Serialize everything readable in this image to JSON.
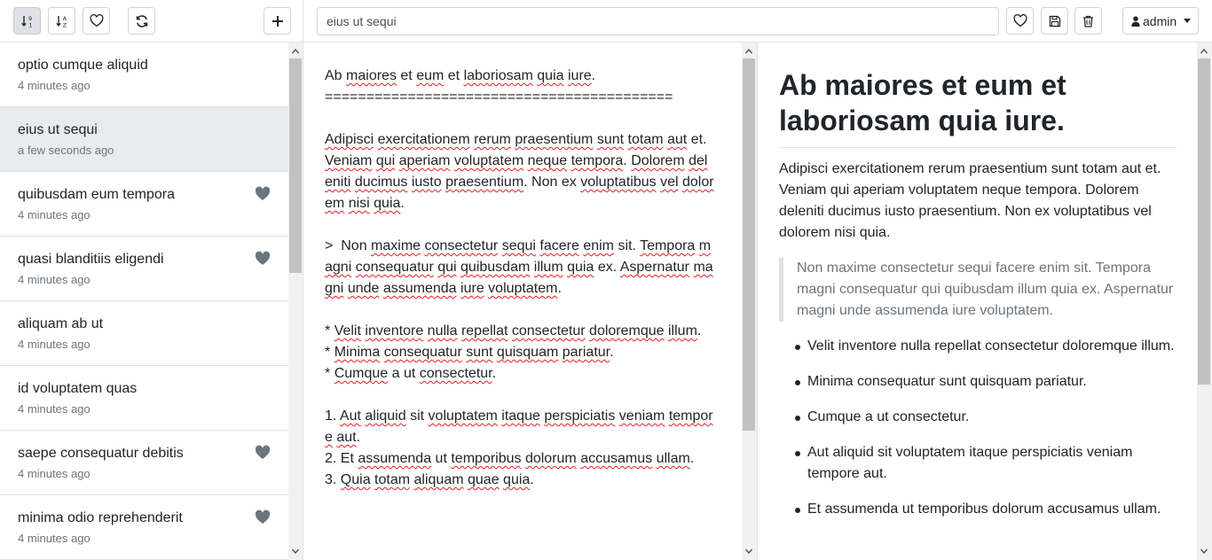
{
  "toolbar": {
    "sort_numeric_icon": "sort-numeric-down-icon",
    "sort_alpha_icon": "sort-alpha-down-icon",
    "favorite_filter_icon": "heart-icon",
    "refresh_icon": "refresh-icon",
    "add_icon": "plus-icon"
  },
  "notes": [
    {
      "title": "optio cumque aliquid",
      "time": "4 minutes ago",
      "favorite": false,
      "selected": false
    },
    {
      "title": "eius ut sequi",
      "time": "a few seconds ago",
      "favorite": false,
      "selected": true
    },
    {
      "title": "quibusdam eum tempora",
      "time": "4 minutes ago",
      "favorite": true,
      "selected": false
    },
    {
      "title": "quasi blanditiis eligendi",
      "time": "4 minutes ago",
      "favorite": true,
      "selected": false
    },
    {
      "title": "aliquam ab ut",
      "time": "4 minutes ago",
      "favorite": false,
      "selected": false
    },
    {
      "title": "id voluptatem quas",
      "time": "4 minutes ago",
      "favorite": false,
      "selected": false
    },
    {
      "title": "saepe consequatur debitis",
      "time": "4 minutes ago",
      "favorite": true,
      "selected": false
    },
    {
      "title": "minima odio reprehenderit",
      "time": "4 minutes ago",
      "favorite": true,
      "selected": false
    }
  ],
  "header": {
    "title_value": "eius ut sequi",
    "user_label": "admin"
  },
  "editor": {
    "lines": [
      "Ab maiores et eum et laboriosam quia iure.",
      "==========================================",
      "",
      "Adipisci exercitationem rerum praesentium sunt totam aut et. Veniam qui aperiam voluptatem neque tempora. Dolorem deleniti ducimus iusto praesentium. Non ex voluptatibus vel dolorem nisi quia.",
      "",
      ">  Non maxime consectetur sequi facere enim sit. Tempora magni consequatur qui quibusdam illum quia ex. Aspernatur magni unde assumenda iure voluptatem.",
      "",
      "* Velit inventore nulla repellat consectetur doloremque illum.",
      "* Minima consequatur sunt quisquam pariatur.",
      "* Cumque a ut consectetur.",
      "",
      "1. Aut aliquid sit voluptatem itaque perspiciatis veniam tempore aut.",
      "2. Et assumenda ut temporibus dolorum accusamus ullam.",
      "3. Quia totam aliquam quae quia."
    ]
  },
  "preview": {
    "heading": "Ab maiores et eum et laboriosam quia iure.",
    "paragraph": "Adipisci exercitationem rerum praesentium sunt totam aut et. Veniam qui aperiam voluptatem neque tempora. Dolorem deleniti ducimus iusto praesentium. Non ex voluptatibus vel dolorem nisi quia.",
    "blockquote": "Non maxime consectetur sequi facere enim sit. Tempora magni consequatur qui quibusdam illum quia ex. Aspernatur magni unde assumenda iure voluptatem.",
    "list": [
      "Velit inventore nulla repellat consectetur doloremque illum.",
      "Minima consequatur sunt quisquam pariatur.",
      "Cumque a ut consectetur.",
      "Aut aliquid sit voluptatem itaque perspiciatis veniam tempore aut.",
      "Et assumenda ut temporibus dolorum accusamus ullam."
    ]
  }
}
